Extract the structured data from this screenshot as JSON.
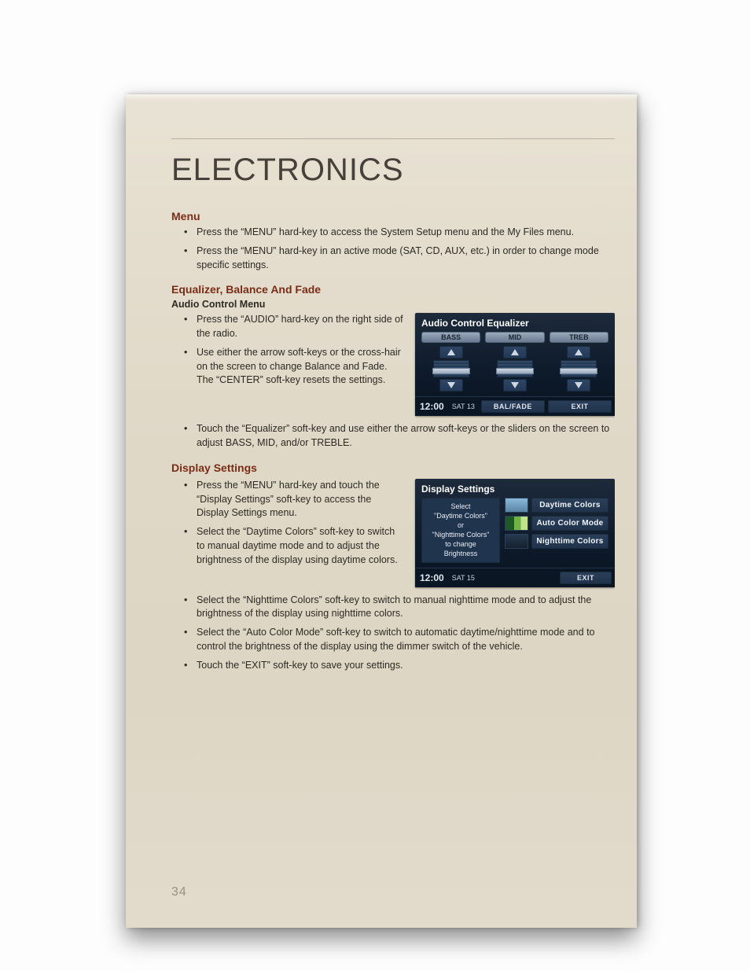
{
  "title": "ELECTRONICS",
  "pageNumber": "34",
  "sections": {
    "menu": {
      "heading": "Menu",
      "bullets": [
        "Press the “MENU” hard-key to access the System Setup menu and the My Files menu.",
        "Press the “MENU” hard-key in an active mode (SAT, CD, AUX, etc.) in order to change mode specific settings."
      ]
    },
    "eq": {
      "heading": "Equalizer, Balance And Fade",
      "sub": "Audio Control Menu",
      "bullets_side": [
        "Press the “AUDIO” hard-key on the right side of the radio.",
        "Use either the arrow soft-keys or the cross-hair on the screen to change Balance and Fade. The “CENTER” soft-key resets the settings."
      ],
      "bullets_below": [
        "Touch the “Equalizer” soft-key and use either the arrow soft-keys or the sliders on the screen to adjust BASS, MID, and/or TREBLE."
      ]
    },
    "disp": {
      "heading": "Display Settings",
      "bullets_side": [
        "Press the “MENU” hard-key and touch the “Display Settings” soft-key to access the Display Settings menu.",
        "Select the “Daytime Colors” soft-key to switch to manual daytime mode and to adjust the brightness of the display using daytime colors."
      ],
      "bullets_below": [
        "Select the “Nighttime Colors” soft-key to switch to manual nighttime mode and to adjust the brightness of the display using nighttime colors.",
        "Select the “Auto Color Mode” soft-key to switch to automatic daytime/nighttime mode and to control the brightness of the display using the dimmer switch of the vehicle.",
        "Touch the “EXIT” soft-key to save your settings."
      ]
    }
  },
  "eqShot": {
    "title": "Audio Control Equalizer",
    "bands": [
      "BASS",
      "MID",
      "TREB"
    ],
    "time": "12:00",
    "sat": "SAT  13",
    "balfade": "BAL/FADE",
    "exit": "EXIT"
  },
  "dispShot": {
    "title": "Display Settings",
    "leftLines": [
      "Select",
      "\"Daytime Colors\"",
      "or",
      "\"Nighttime Colors\"",
      "to change",
      "Brightness"
    ],
    "buttons": {
      "day": "Daytime Colors",
      "auto": "Auto Color Mode",
      "night": "Nighttime Colors"
    },
    "time": "12:00",
    "sat": "SAT  15",
    "exit": "EXIT"
  }
}
